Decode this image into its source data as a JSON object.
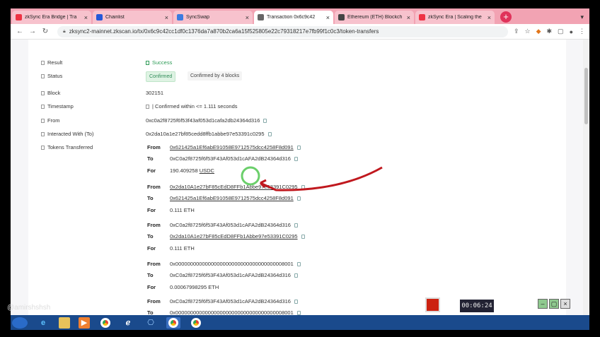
{
  "browser": {
    "tabs": [
      {
        "title": "zkSync Era Bridge | Tra",
        "color": "#e34",
        "active": false
      },
      {
        "title": "Chainlist",
        "color": "#2458d8",
        "active": false
      },
      {
        "title": "SyncSwap",
        "color": "#3b7be0",
        "active": false
      },
      {
        "title": "Transaction 0x6c9c42",
        "color": "#666",
        "active": true
      },
      {
        "title": "Ethereum (ETH) Blockch",
        "color": "#444",
        "active": false
      },
      {
        "title": "zkSync Era | Scaling the",
        "color": "#e34",
        "active": false
      }
    ],
    "new_tab": "+",
    "url": "zksync2-mainnet.zkscan.io/tx/0x6c9c42cc1df0c1376da7a870b2ca6a15f525805e22c79318217e7fb99f1c0c3/token-transfers"
  },
  "tx": {
    "result_label": "Result",
    "result_value": "Success",
    "status_label": "Status",
    "status_badge": "Confirmed",
    "status_blocks": "Confirmed by 4 blocks",
    "block_label": "Block",
    "block_value": "302151",
    "timestamp_label": "Timestamp",
    "timestamp_value": "| Confirmed within <= 1.111 seconds",
    "from_label": "From",
    "from_value": "0xc0a2f8725f6f53f43af053d1cafa2db24364d316",
    "interacted_label": "Interacted With (To)",
    "interacted_value": "0x2da10a1e27bf85cedd8ffb1abbe97e53391c0295",
    "tokens_label": "Tokens Transferred"
  },
  "transfers": [
    {
      "from": "0x621425a1Ef6abE91058E9712575dcc4258F8d091",
      "to": "0xC0a2f8725f6f53F43Af053d1cAFA2dB24364d316",
      "for": "190.409258",
      "token": "USDC",
      "from_link": true,
      "to_link": false
    },
    {
      "from": "0x2da10A1e27bF85cEdD8FFb1Abbe97e53391C0295",
      "to": "0x621425a1Ef6abE91058E9712575dcc4258F8d091",
      "for": "0.111",
      "token": "ETH",
      "from_link": true,
      "to_link": true
    },
    {
      "from": "0xC0a2f8725f6f53F43Af053d1cAFA2dB24364d316",
      "to": "0x2da10A1e27bF85cEdD8FFb1Abbe97e53391C0295",
      "for": "0.111",
      "token": "ETH",
      "from_link": false,
      "to_link": true
    },
    {
      "from": "0x0000000000000000000000000000000000008001",
      "to": "0xC0a2f8725f6f53F43Af053d1cAFA2dB24364d316",
      "for": "0.00067998295",
      "token": "ETH",
      "from_link": false,
      "to_link": false
    },
    {
      "from": "0xC0a2f8725f6f53F43Af053d1cAFA2dB24364d316",
      "to": "0x0000000000000000000000000000000000008001",
      "for": "",
      "token": "",
      "from_link": false,
      "to_link": false
    }
  ],
  "labels": {
    "from": "From",
    "to": "To",
    "for": "For"
  },
  "overlay": {
    "watermark": "@amirshshsh",
    "clock": "00:06:24"
  }
}
